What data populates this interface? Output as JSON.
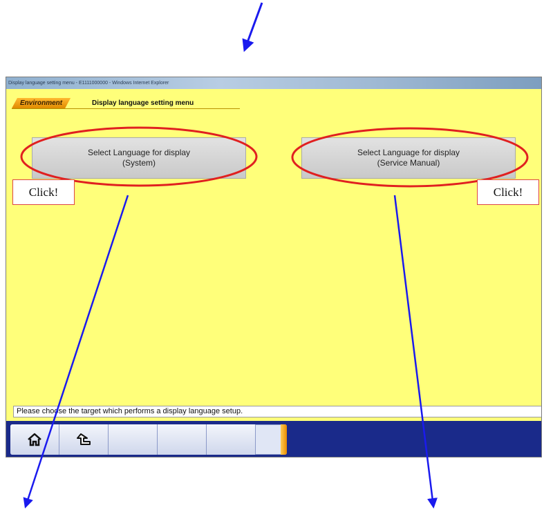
{
  "window": {
    "title": "Display language setting menu - E1111000000 - Windows Internet Explorer"
  },
  "breadcrumb": {
    "root": "Environment",
    "current": "Display language setting menu"
  },
  "buttons": {
    "system": {
      "line1": "Select Language for display",
      "line2": "(System)"
    },
    "manual": {
      "line1": "Select Language for display",
      "line2": "(Service Manual)"
    }
  },
  "callouts": {
    "left": "Click!",
    "right": "Click!"
  },
  "status_text": "Please choose the target which performs a display language setup.",
  "toolbar": {
    "buttons": [
      {
        "icon": "home-icon"
      },
      {
        "icon": "return-arrow-icon"
      },
      {
        "icon": ""
      },
      {
        "icon": ""
      },
      {
        "icon": ""
      }
    ]
  },
  "colors": {
    "content_bg": "#ffff7a",
    "toolbar_bg": "#1a2a8a",
    "highlight_ellipse": "#e02020",
    "annotation_arrow": "#1a1aee",
    "breadcrumb_tab": "#f0a000"
  }
}
